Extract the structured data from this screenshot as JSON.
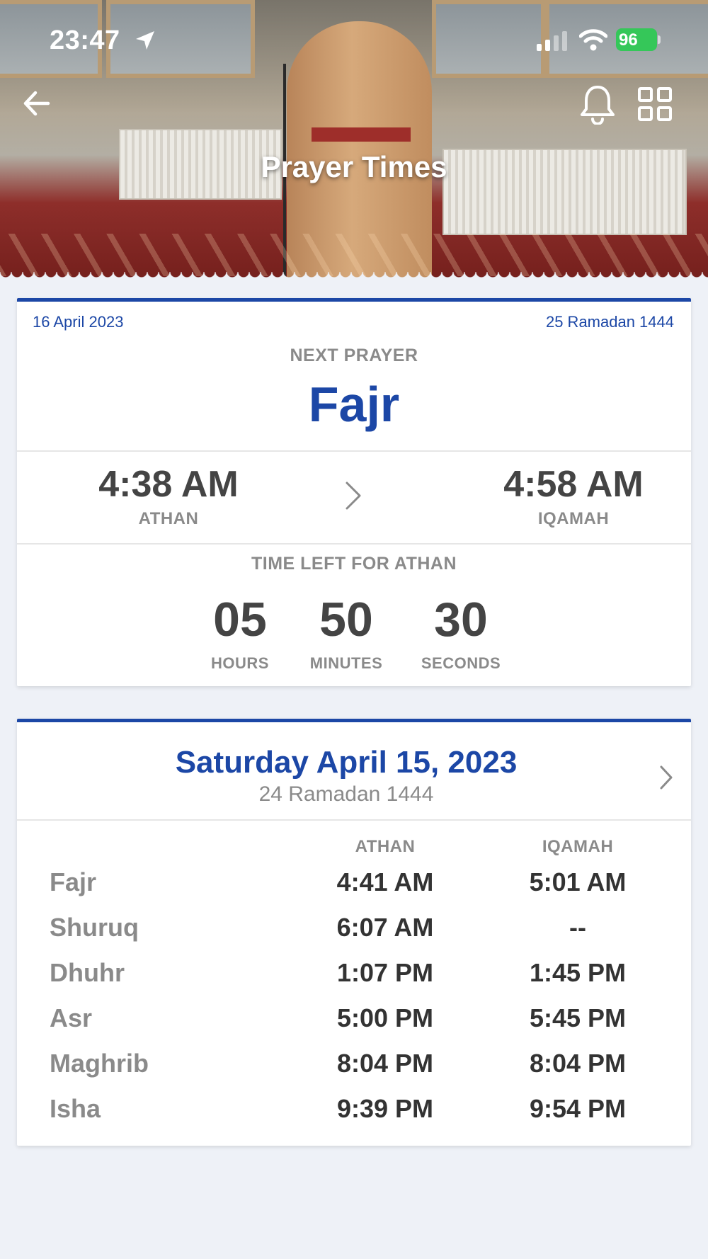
{
  "status_bar": {
    "time": "23:47",
    "battery": "96"
  },
  "header": {
    "title": "Prayer Times"
  },
  "next_prayer": {
    "gregorian_date": "16 April 2023",
    "hijri_date": "25 Ramadan 1444",
    "label": "NEXT PRAYER",
    "name": "Fajr",
    "athan_time": "4:38 AM",
    "athan_label": "ATHAN",
    "iqamah_time": "4:58 AM",
    "iqamah_label": "IQAMAH",
    "countdown_label": "TIME LEFT FOR ATHAN",
    "countdown": {
      "hours": "05",
      "hours_label": "HOURS",
      "minutes": "50",
      "minutes_label": "MINUTES",
      "seconds": "30",
      "seconds_label": "SECONDS"
    }
  },
  "schedule": {
    "date_title": "Saturday April 15, 2023",
    "hijri_date": "24 Ramadan 1444",
    "col_athan": "ATHAN",
    "col_iqamah": "IQAMAH",
    "rows": [
      {
        "name": "Fajr",
        "athan": "4:41 AM",
        "iqamah": "5:01 AM"
      },
      {
        "name": "Shuruq",
        "athan": "6:07 AM",
        "iqamah": "--"
      },
      {
        "name": "Dhuhr",
        "athan": "1:07 PM",
        "iqamah": "1:45 PM"
      },
      {
        "name": "Asr",
        "athan": "5:00 PM",
        "iqamah": "5:45 PM"
      },
      {
        "name": "Maghrib",
        "athan": "8:04 PM",
        "iqamah": "8:04 PM"
      },
      {
        "name": "Isha",
        "athan": "9:39 PM",
        "iqamah": "9:54 PM"
      }
    ]
  },
  "colors": {
    "accent": "#1c47a6",
    "background": "#eef1f7",
    "battery": "#35c759"
  },
  "icons": {
    "back": "arrow-left-icon",
    "notifications": "bell-icon",
    "menu": "grid-icon",
    "next": "chevron-right-icon",
    "location": "location-arrow-icon"
  }
}
